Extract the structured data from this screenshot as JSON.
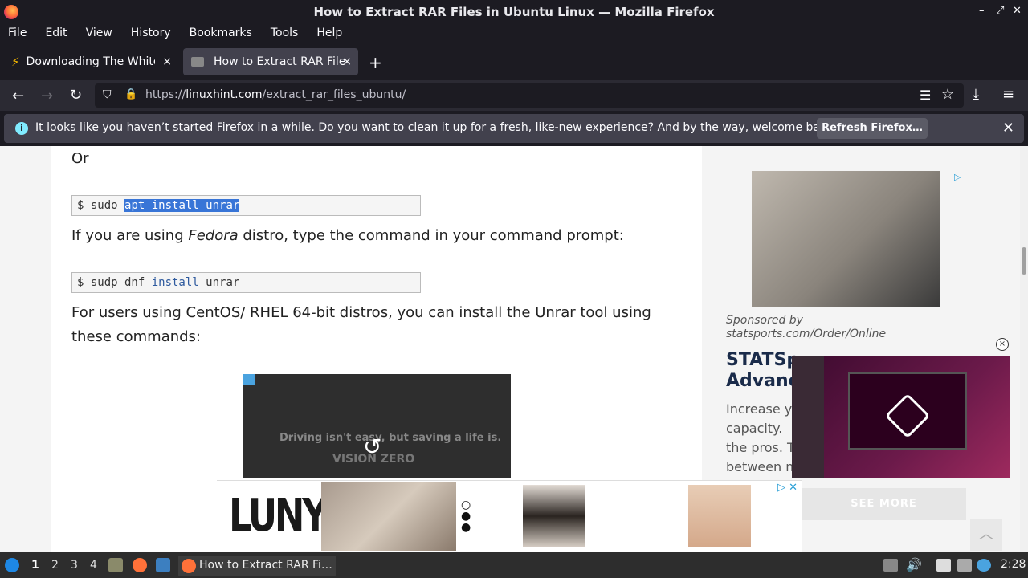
{
  "window": {
    "title": "How to Extract RAR Files in Ubuntu Linux — Mozilla Firefox",
    "minimize": "–",
    "restore": "⤢",
    "close": "✕"
  },
  "menu": [
    "File",
    "Edit",
    "View",
    "History",
    "Bookmarks",
    "Tools",
    "Help"
  ],
  "tabs": [
    {
      "label": "Downloading The White …",
      "active": false
    },
    {
      "label": "How to Extract RAR Files",
      "active": true
    }
  ],
  "tab_close": "×",
  "new_tab": "+",
  "nav": {
    "back": "←",
    "forward": "→",
    "reload": "↻",
    "shield": "⛉",
    "lock": "🔒",
    "url_prefix": "https://",
    "url_domain": "linuxhint.com",
    "url_path": "/extract_rar_files_ubuntu/",
    "reader": "☰",
    "star": "☆",
    "download": "⤓",
    "menu": "≡"
  },
  "notification": {
    "info_glyph": "i",
    "text": "It looks like you haven’t started Firefox in a while. Do you want to clean it up for a fresh, like-new experience? And by the way, welcome back!",
    "button": "Refresh Firefox…",
    "close": "✕"
  },
  "article": {
    "or": "Or",
    "cmd1_prompt": "$ sudo ",
    "cmd1_selected": "apt install unrar",
    "fedora_pre": "If you are using ",
    "fedora_em": "Fedora",
    "fedora_post": " distro, type the command in your command prompt:",
    "cmd2_prompt": "$ sudp dnf ",
    "cmd2_kw": "install",
    "cmd2_rest": " unrar",
    "centos_line1": "For users using CentOS/ RHEL 64-bit distros, you can install the Unrar tool using",
    "centos_line2": "these commands:",
    "video_text": "Driving isn't easy, but saving a life is.",
    "video_brand": "VISION ZERO",
    "replay_glyph": "↺"
  },
  "sidebar": {
    "ad_choice": "▷",
    "sponsor": "Sponsored by statsports.com/Order/Online",
    "ad_title_1": "STATSp",
    "ad_title_2": "Advanc",
    "ad_desc": [
      "Increase y",
      "capacity.",
      "the pros. T",
      "between m"
    ],
    "float_close": "×"
  },
  "bottom_ad": {
    "brand": "LUNYA",
    "see_more": "SEE MORE",
    "ad_x": "▷ ✕",
    "up": "︿"
  },
  "taskbar": {
    "workspaces": [
      "1",
      "2",
      "3",
      "4"
    ],
    "current_workspace": "1",
    "task_label": "How to Extract RAR Fi…",
    "clock": "2:28"
  }
}
